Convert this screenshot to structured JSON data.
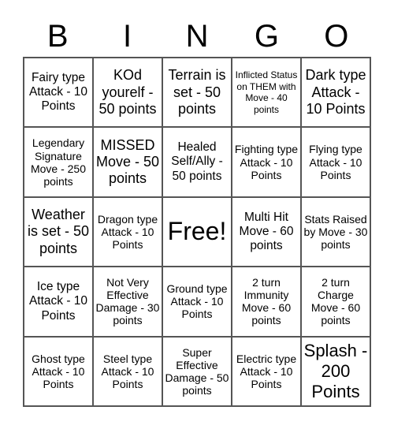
{
  "header": [
    "B",
    "I",
    "N",
    "G",
    "O"
  ],
  "cells": [
    "Fairy type Attack - 10 Points",
    "KOd yourelf - 50 points",
    "Terrain is set - 50 points",
    "Inflicted Status on THEM with Move - 40 points",
    "Dark type Attack - 10 Points",
    "Legendary Signature Move - 250 points",
    "MISSED Move - 50 points",
    "Healed Self/Ally - 50 points",
    "Fighting type Attack - 10 Points",
    "Flying type Attack - 10 Points",
    "Weather is set - 50 points",
    "Dragon type Attack - 10 Points",
    "Free!",
    "Multi Hit Move - 60 points",
    "Stats Raised by Move - 30 points",
    "Ice type Attack - 10 Points",
    "Not Very Effective Damage - 30 points",
    "Ground type Attack - 10 Points",
    "2 turn Immunity Move - 60 points",
    "2 turn Charge Move - 60 points",
    "Ghost type Attack - 10 Points",
    "Steel type Attack - 10 Points",
    "Super Effective Damage - 50 points",
    "Electric type Attack - 10 Points",
    "Splash - 200 Points"
  ]
}
